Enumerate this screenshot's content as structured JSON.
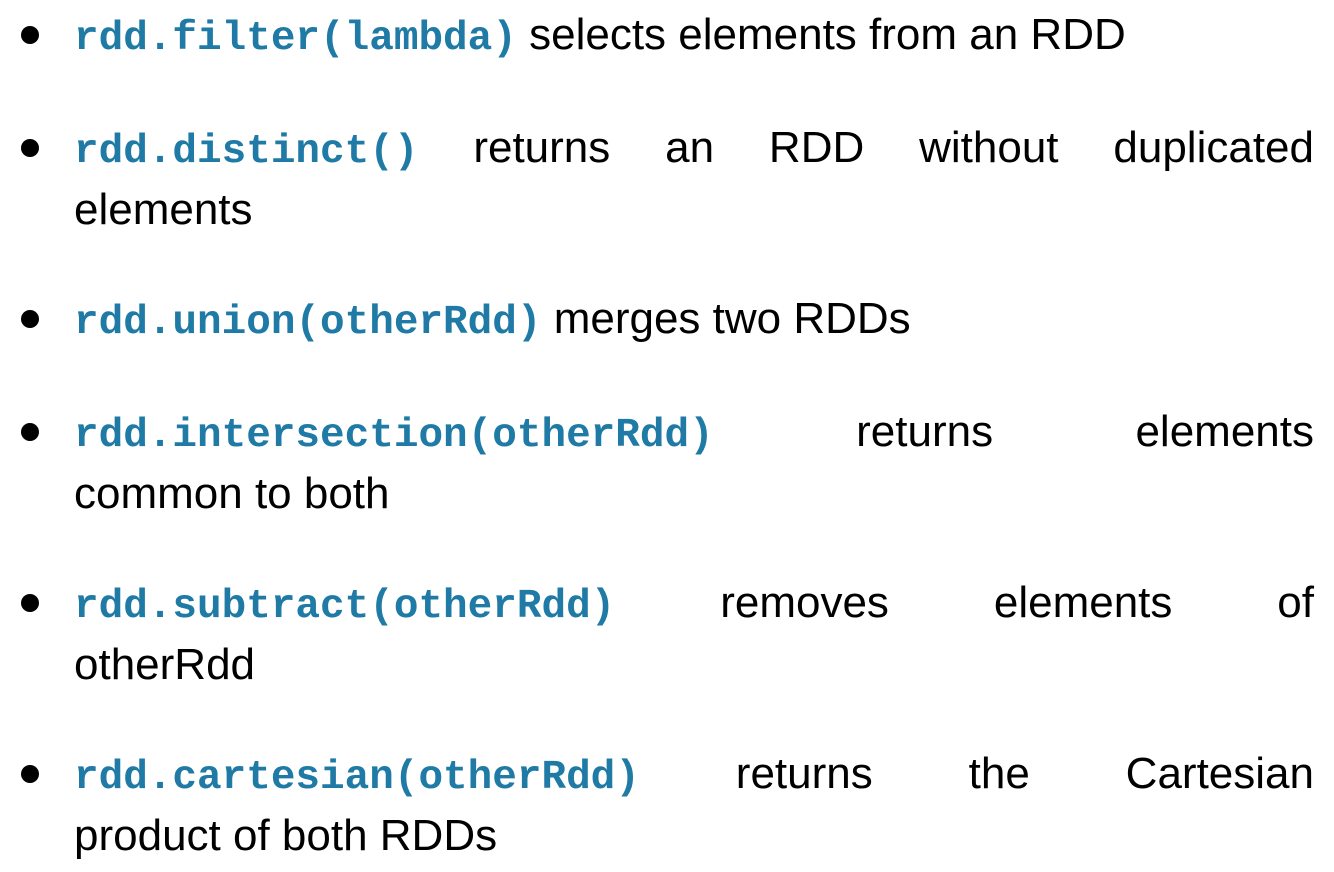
{
  "colors": {
    "code": "#1f7aa5",
    "text": "#000000",
    "background": "#ffffff"
  },
  "items": [
    {
      "code": "rdd.filter(lambda)",
      "desc_line1": "selects elements from an RDD",
      "desc_line2": ""
    },
    {
      "code": "rdd.distinct()",
      "desc_line1": "returns an RDD without duplicated",
      "desc_line2": "elements"
    },
    {
      "code": "rdd.union(otherRdd)",
      "desc_line1": "merges two RDDs",
      "desc_line2": ""
    },
    {
      "code": "rdd.intersection(otherRdd)",
      "desc_line1": "returns elements",
      "desc_line2": "common to both"
    },
    {
      "code": "rdd.subtract(otherRdd)",
      "desc_line1": "removes elements of",
      "desc_line2": "otherRdd"
    },
    {
      "code": "rdd.cartesian(otherRdd)",
      "desc_line1": "returns the Cartesian",
      "desc_line2": "product of both RDDs"
    }
  ]
}
